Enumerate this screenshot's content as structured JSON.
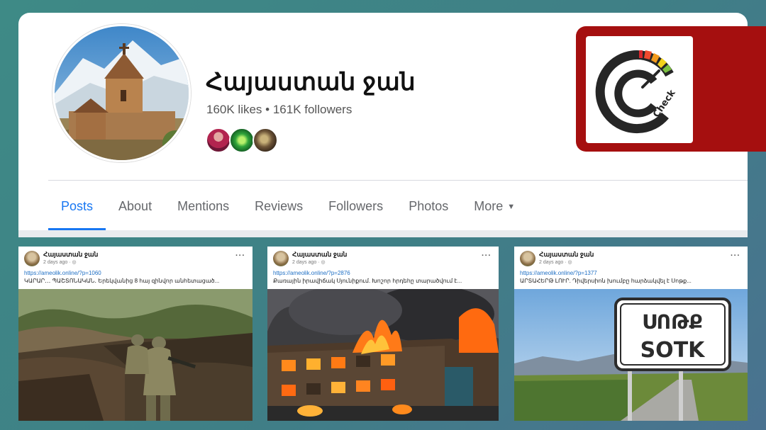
{
  "page": {
    "name": "Հայաստան ջան",
    "stats": "160K likes • 161K followers"
  },
  "tabs": [
    {
      "label": "Posts",
      "active": true
    },
    {
      "label": "About"
    },
    {
      "label": "Mentions"
    },
    {
      "label": "Reviews"
    },
    {
      "label": "Followers"
    },
    {
      "label": "Photos"
    },
    {
      "label": "More"
    }
  ],
  "badge": {
    "logo_text": "Check",
    "colors": {
      "frame": "#a50f0f",
      "accent": "#1877f2"
    }
  },
  "posts": [
    {
      "author": "Հայաստան ջան",
      "time": "2 days ago · ◎",
      "link": "https://ameolik.online/?p=1060",
      "text": "ԿԱՐԱՐ․․․ ՊԱՇՏՈՆԱԿԱՆ․ Երեկվանից 8 հայ զինվոր անհետացած...",
      "image": "soldiers-trench"
    },
    {
      "author": "Հայաստան ջան",
      "time": "2 days ago · ◎",
      "link": "https://ameolik.online/?p=2876",
      "text": "Քառային իրավիճակ Սյունիքում. Խոշոր հրդեհը տարածվում է...",
      "image": "building-fire"
    },
    {
      "author": "Հայաստան ջան",
      "time": "2 days ago · ◎",
      "link": "https://ameolik.online/?p=1377",
      "text": "ԱՐՏԱՀԵՐԹ ԼՈՒՐ. Դիվերսիոն խումբը հարձակվել է Սոթք...",
      "image": "sotk-road-sign",
      "sign_top": "ՍՈԹՔ",
      "sign_bottom": "SOTK"
    }
  ]
}
